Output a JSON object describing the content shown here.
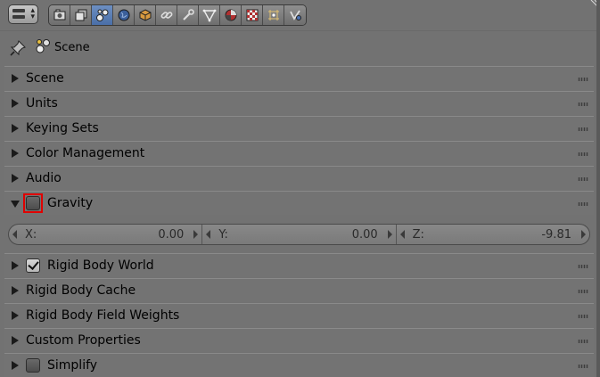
{
  "header": {
    "editor_type_icon": "properties-editor-icon",
    "context_buttons": [
      {
        "name": "render-icon",
        "active": false
      },
      {
        "name": "render-layers-icon",
        "active": false
      },
      {
        "name": "scene-icon",
        "active": true
      },
      {
        "name": "world-icon",
        "active": false
      },
      {
        "name": "object-icon",
        "active": false
      },
      {
        "name": "constraints-icon",
        "active": false
      },
      {
        "name": "modifiers-icon",
        "active": false
      },
      {
        "name": "data-icon",
        "active": false
      },
      {
        "name": "material-icon",
        "active": false
      },
      {
        "name": "texture-icon",
        "active": false
      },
      {
        "name": "particles-icon",
        "active": false
      },
      {
        "name": "physics-icon",
        "active": false
      }
    ]
  },
  "context": {
    "label": "Scene",
    "pin_icon": "pin-icon",
    "scene_icon": "scene-icon"
  },
  "panels": [
    {
      "label": "Scene",
      "expanded": false,
      "checkbox": null
    },
    {
      "label": "Units",
      "expanded": false,
      "checkbox": null
    },
    {
      "label": "Keying Sets",
      "expanded": false,
      "checkbox": null
    },
    {
      "label": "Color Management",
      "expanded": false,
      "checkbox": null
    },
    {
      "label": "Audio",
      "expanded": false,
      "checkbox": null
    },
    {
      "label": "Gravity",
      "expanded": true,
      "checkbox": false
    },
    {
      "label": "Rigid Body World",
      "expanded": false,
      "checkbox": true
    },
    {
      "label": "Rigid Body Cache",
      "expanded": false,
      "checkbox": null
    },
    {
      "label": "Rigid Body Field Weights",
      "expanded": false,
      "checkbox": null
    },
    {
      "label": "Custom Properties",
      "expanded": false,
      "checkbox": null
    },
    {
      "label": "Simplify",
      "expanded": false,
      "checkbox": false
    }
  ],
  "gravity": {
    "x_label": "X:",
    "x_value": "0.00",
    "y_label": "Y:",
    "y_value": "0.00",
    "z_label": "Z:",
    "z_value": "-9.81"
  },
  "colors": {
    "background": "#727272",
    "active_tab": "#5a7fb8",
    "highlight": "#e00000"
  }
}
